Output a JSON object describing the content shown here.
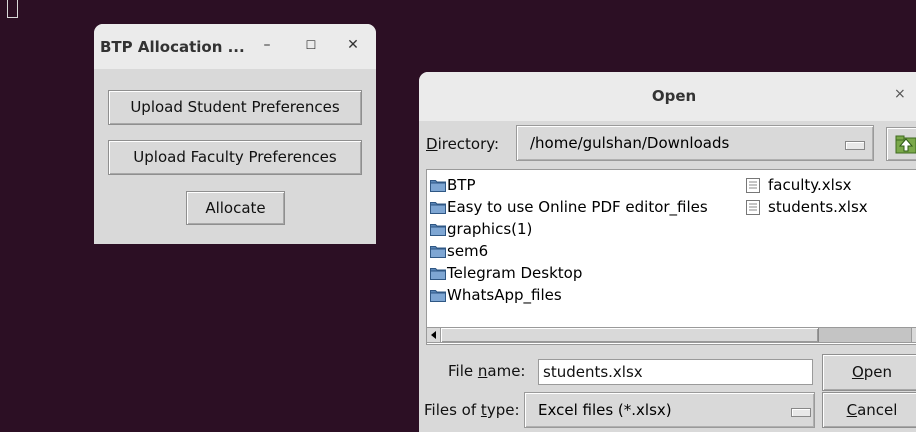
{
  "app_window": {
    "title": "BTP Allocation ...",
    "minimize_glyph": "–",
    "maximize_glyph": "☐",
    "close_glyph": "✕",
    "upload_student_label": "Upload Student Preferences",
    "upload_faculty_label": "Upload Faculty Preferences",
    "allocate_label": "Allocate"
  },
  "open_dialog": {
    "title": "Open",
    "close_glyph": "×",
    "directory_label_u": "D",
    "directory_label_rest": "irectory:",
    "directory_value": "/home/gulshan/Downloads",
    "folders": [
      "BTP",
      "Easy to use Online PDF editor_files",
      "graphics(1)",
      "sem6",
      "Telegram Desktop",
      "WhatsApp_files"
    ],
    "files": [
      "faculty.xlsx",
      "students.xlsx"
    ],
    "file_name_label_pre": "File ",
    "file_name_label_u": "n",
    "file_name_label_post": "ame:",
    "file_name_value": "students.xlsx",
    "files_of_type_label_pre": "Files of ",
    "files_of_type_label_u": "t",
    "files_of_type_label_post": "ype:",
    "files_of_type_value": "Excel files (*.xlsx)",
    "open_button_u": "O",
    "open_button_rest": "pen",
    "cancel_button_u": "C",
    "cancel_button_rest": "ancel"
  },
  "colors": {
    "desktop": "#2c0f24",
    "folder_icon": "#5a86b7",
    "window_bg": "#d9d9d9",
    "titlebar_bg": "#ebebeb"
  }
}
